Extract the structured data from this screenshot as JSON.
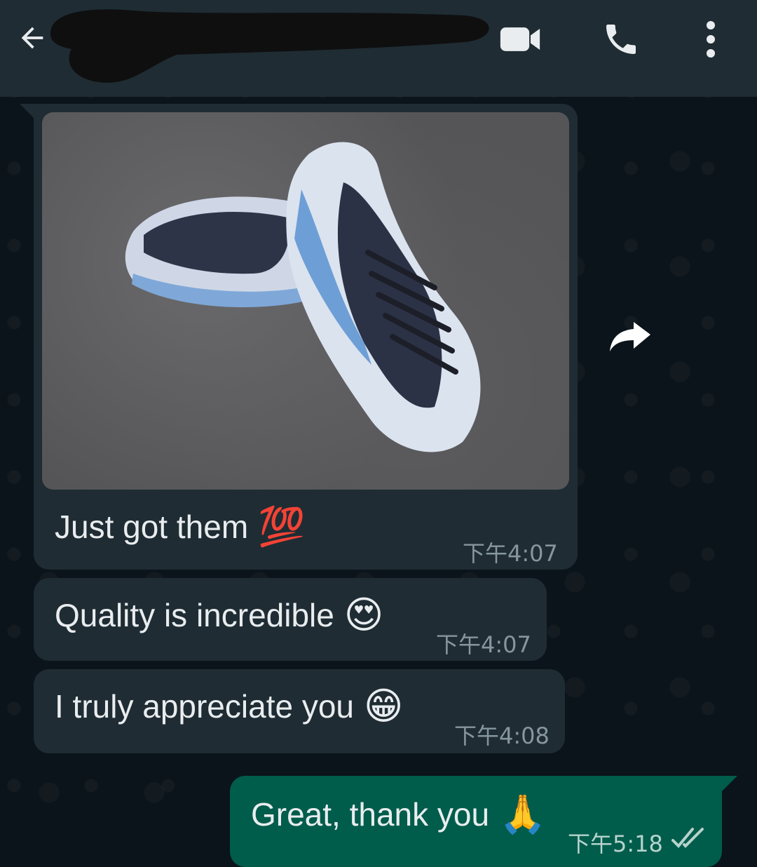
{
  "header": {
    "back_icon": "arrow-left-icon",
    "contact_name_redacted": true,
    "video_icon": "video-camera-icon",
    "call_icon": "phone-icon",
    "menu_icon": "more-vertical-icon"
  },
  "messages": [
    {
      "direction": "incoming",
      "type": "image",
      "image_subject": "photo",
      "text": "Just got them",
      "emoji": "💯",
      "time": "下午4:07"
    },
    {
      "direction": "incoming",
      "type": "text",
      "text": "Quality is incredible",
      "emoji": "😍",
      "time": "下午4:07"
    },
    {
      "direction": "incoming",
      "type": "text",
      "text": "I truly appreciate you",
      "emoji": "😁",
      "time": "下午4:08"
    },
    {
      "direction": "outgoing",
      "type": "text",
      "text": "Great, thank you",
      "emoji": "🙏",
      "time": "下午5:18",
      "status": "read",
      "status_icon": "double-check-icon"
    }
  ],
  "forward_icon": "forward-arrow-icon",
  "colors": {
    "background": "#0b141a",
    "header": "#1f2c33",
    "incoming_bubble": "#1f2c33",
    "outgoing_bubble": "#005c4b",
    "text": "#e9edef",
    "timestamp": "#8696a0"
  }
}
